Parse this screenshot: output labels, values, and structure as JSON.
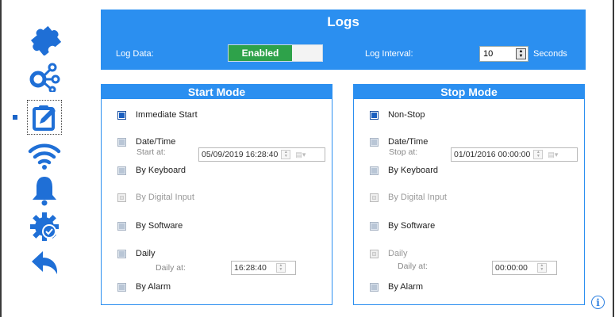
{
  "header": {
    "title": "Logs",
    "log_data_label": "Log Data:",
    "log_data_state": "Enabled",
    "log_interval_label": "Log Interval:",
    "log_interval_value": "10",
    "log_interval_unit": "Seconds"
  },
  "sidebar": {
    "items": [
      {
        "icon": "puzzle-icon"
      },
      {
        "icon": "network-icon"
      },
      {
        "icon": "edit-log-icon",
        "active": true
      },
      {
        "icon": "wifi-icon"
      },
      {
        "icon": "bell-icon"
      },
      {
        "icon": "gear-check-icon"
      },
      {
        "icon": "back-arrow-icon"
      }
    ]
  },
  "start_mode": {
    "title": "Start Mode",
    "immediate": "Immediate Start",
    "datetime": "Date/Time",
    "datetime_sub": "Start at:",
    "datetime_value": "05/09/2019  16:28:40",
    "keyboard": "By Keyboard",
    "digital_input": "By Digital Input",
    "software": "By Software",
    "daily": "Daily",
    "daily_sub": "Daily at:",
    "daily_value": "16:28:40",
    "alarm": "By Alarm"
  },
  "stop_mode": {
    "title": "Stop Mode",
    "nonstop": "Non-Stop",
    "datetime": "Date/Time",
    "datetime_sub": "Stop at:",
    "datetime_value": "01/01/2016  00:00:00",
    "keyboard": "By Keyboard",
    "digital_input": "By Digital Input",
    "software": "By Software",
    "daily": "Daily",
    "daily_sub": "Daily at:",
    "daily_value": "00:00:00",
    "alarm": "By Alarm"
  },
  "colors": {
    "accent": "#2b8ff0",
    "enabled": "#2ea24a",
    "sidebar_icon": "#1f6fd6"
  }
}
